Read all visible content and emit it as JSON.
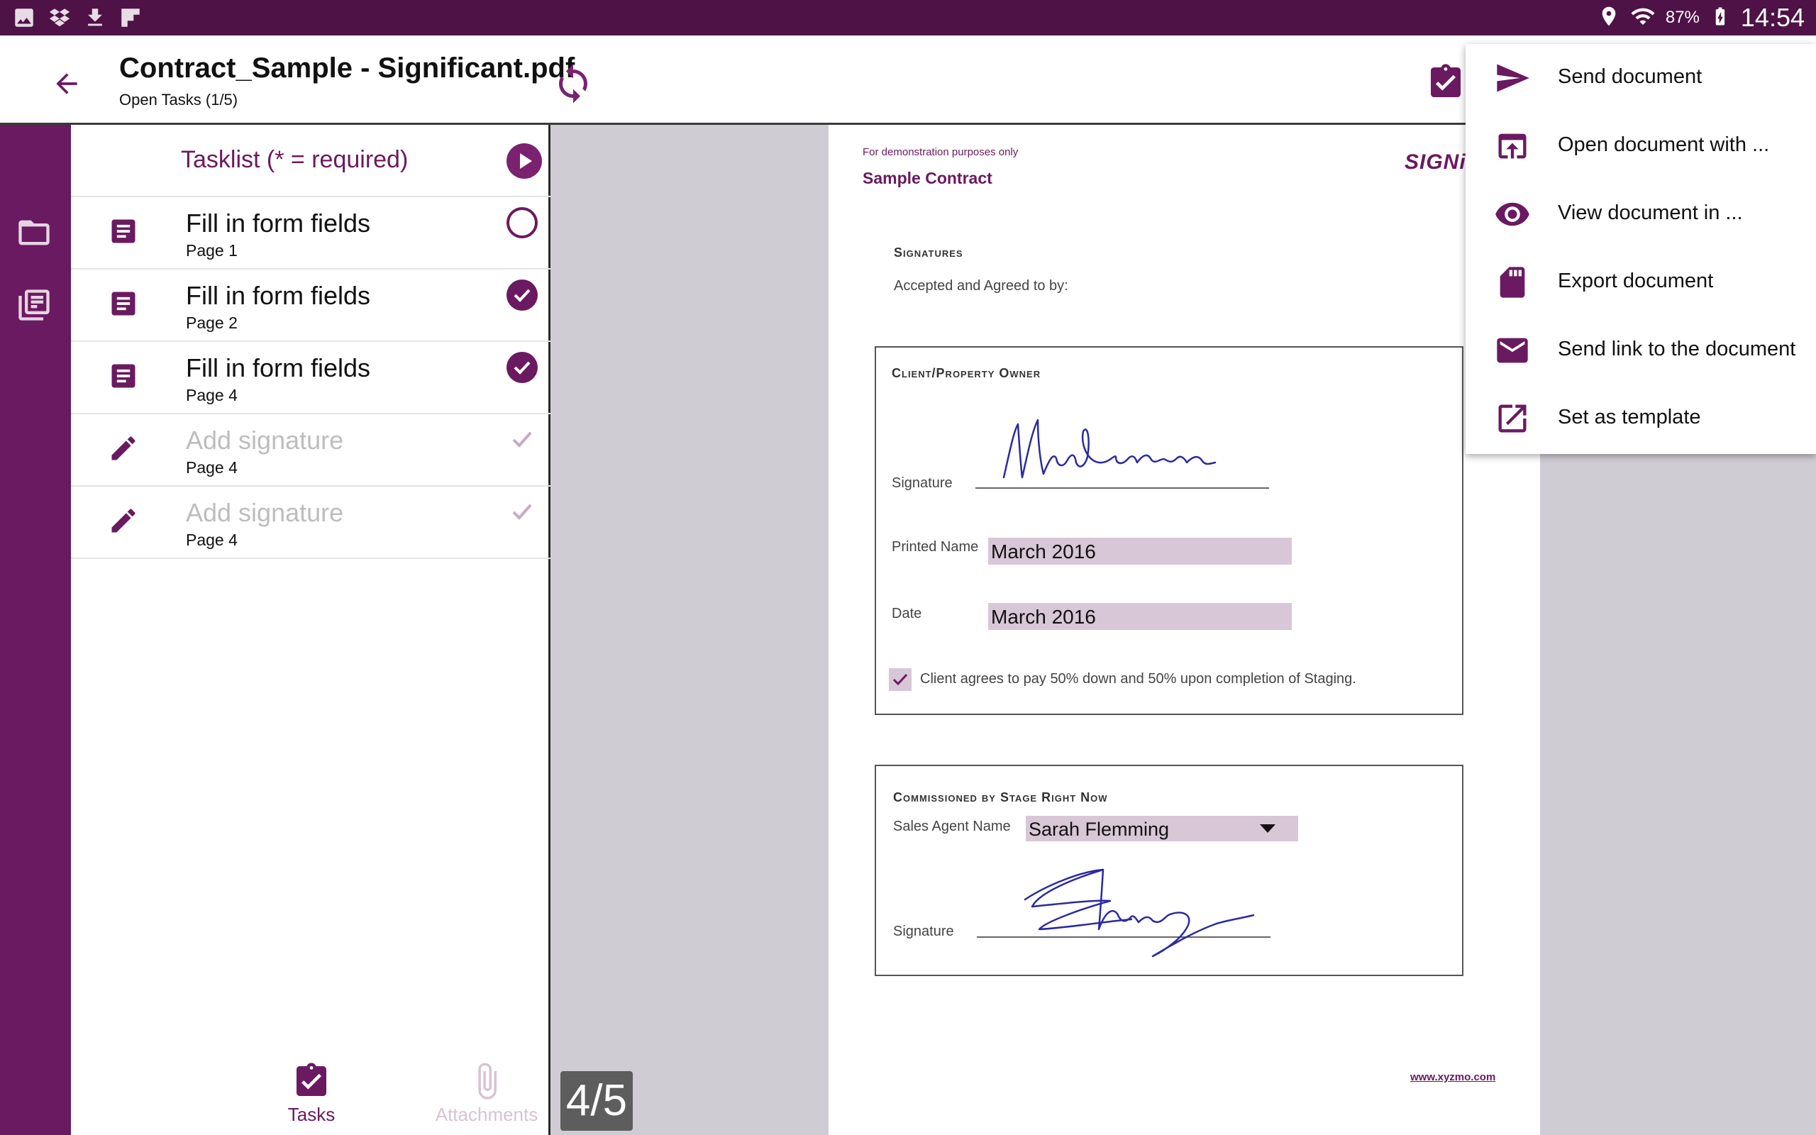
{
  "status_bar": {
    "battery_percent": "87%",
    "time": "14:54",
    "left_icons": [
      "gallery-icon",
      "dropbox-icon",
      "download-icon",
      "flipboard-icon"
    ],
    "right_icons": [
      "location-icon",
      "wifi-icon",
      "battery-charging-icon"
    ]
  },
  "app_bar": {
    "title": "Contract_Sample - Significant.pdf",
    "subtitle": "Open Tasks (1/5)"
  },
  "tasklist": {
    "header": "Tasklist (* = required)",
    "items": [
      {
        "label": "Fill in form fields",
        "page": "Page 1",
        "type": "form",
        "status": "open"
      },
      {
        "label": "Fill in form fields",
        "page": "Page 2",
        "type": "form",
        "status": "done"
      },
      {
        "label": "Fill in form fields",
        "page": "Page 4",
        "type": "form",
        "status": "done"
      },
      {
        "label": "Add signature",
        "page": "Page 4",
        "type": "signature",
        "status": "signed"
      },
      {
        "label": "Add signature",
        "page": "Page 4",
        "type": "signature",
        "status": "signed"
      }
    ],
    "tabs": {
      "tasks": "Tasks",
      "attachments": "Attachments"
    }
  },
  "document": {
    "demo_note": "For demonstration purposes only",
    "title": "Sample Contract",
    "signatures_heading": "Signatures",
    "accepted_text": "Accepted and Agreed to by:",
    "client_box": {
      "heading": "Client/Property Owner",
      "signature_label": "Signature",
      "printed_name_label": "Printed Name",
      "printed_name_value": "March 2016",
      "date_label": "Date",
      "date_value": "March 2016",
      "consent_checked": true,
      "consent_text": "Client agrees to pay 50% down and 50% upon completion of Staging."
    },
    "commission_box": {
      "heading": "Commissioned by Stage Right Now",
      "agent_label": "Sales Agent Name",
      "agent_value": "Sarah Flemming",
      "signature_label": "Signature"
    },
    "footer_link": "www.xyzmo.com",
    "page_indicator": "4/5"
  },
  "menu": {
    "items": [
      {
        "label": "Send document",
        "icon": "send-icon"
      },
      {
        "label": "Open document with ...",
        "icon": "open-with-icon"
      },
      {
        "label": "View document in ...",
        "icon": "eye-icon"
      },
      {
        "label": "Export document",
        "icon": "sd-card-icon"
      },
      {
        "label": "Send link to the document",
        "icon": "mail-icon"
      },
      {
        "label": "Set as template",
        "icon": "external-link-icon"
      }
    ]
  },
  "colors": {
    "brand": "#6a1a60",
    "status_bar": "#4e1247",
    "field_fill": "#d8c7d6",
    "signature_ink": "#2b2aa0"
  }
}
